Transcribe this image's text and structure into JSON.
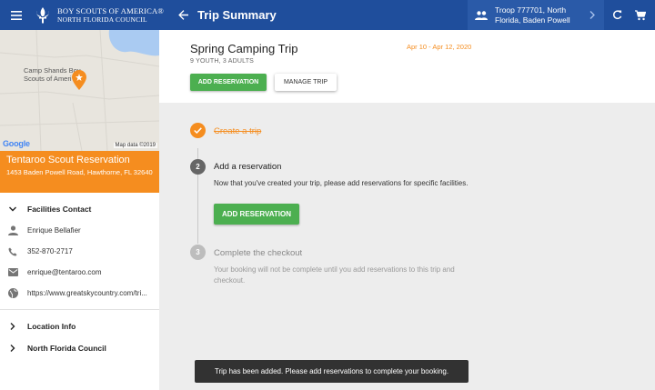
{
  "header": {
    "logo_line1": "BOY SCOUTS OF AMERICA®",
    "logo_line2": "NORTH FLORIDA COUNCIL",
    "title": "Trip Summary",
    "troop": "Troop 777701, North Florida, Baden Powell"
  },
  "map": {
    "label_line1": "Camp Shands Boy",
    "label_line2": "Scouts of Ameri",
    "google": "Google",
    "map_data": "Map data ©2019"
  },
  "venue": {
    "name": "Tentaroo Scout Reservation",
    "address": "1453 Baden Powell Road, Hawthorne, FL 32640"
  },
  "sidebar": {
    "facilities_contact": "Facilities Contact",
    "contact_name": "Enrique Bellafier",
    "contact_phone": "352-870-2717",
    "contact_email": "enrique@tentaroo.com",
    "contact_url": "https://www.greatskycountry.com/tri...",
    "location_info": "Location Info",
    "council": "North Florida Council"
  },
  "trip": {
    "name": "Spring Camping Trip",
    "meta": "9 YOUTH, 3 ADULTS",
    "dates": "Apr 10 - Apr 12, 2020",
    "add_reservation_label": "ADD RESERVATION",
    "manage_trip_label": "MANAGE TRIP"
  },
  "steps": {
    "step1_title": "Create a trip",
    "step2_number": "2",
    "step2_title": "Add a reservation",
    "step2_desc": "Now that you've created your trip, please add reservations for specific facilities.",
    "step2_button": "ADD RESERVATION",
    "step3_number": "3",
    "step3_title": "Complete the checkout",
    "step3_desc": "Your booking will not be complete until you add reservations to this trip and checkout."
  },
  "toast": "Trip has been added. Please add reservations to complete your booking.",
  "colors": {
    "header_blue": "#1f4e9c",
    "accent_orange": "#f58d1f",
    "button_green": "#4caf50"
  }
}
